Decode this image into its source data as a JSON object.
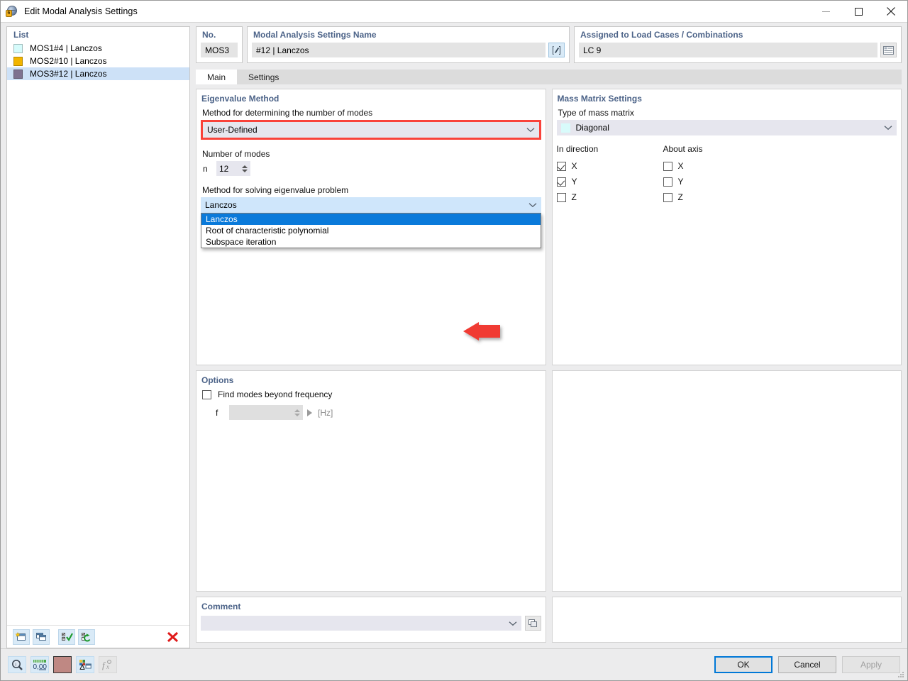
{
  "window": {
    "title": "Edit Modal Analysis Settings",
    "icon": "modal-analysis-icon",
    "minimize": "–",
    "maximize": "□",
    "close": "✕"
  },
  "list_panel": {
    "legend": "List",
    "rows": [
      {
        "color": "#d6fbfb",
        "no": "MOS1",
        "desc": "#4 | Lanczos",
        "selected": false
      },
      {
        "color": "#f2b500",
        "no": "MOS2",
        "desc": "#10 | Lanczos",
        "selected": false
      },
      {
        "color": "#7e7291",
        "no": "MOS3",
        "desc": "#12 | Lanczos",
        "selected": true
      }
    ],
    "toolbar": [
      {
        "name": "new-item-button",
        "icon": "new-window-icon"
      },
      {
        "name": "copy-item-button",
        "icon": "copy-window-icon"
      },
      {
        "name": "select-all-button",
        "icon": "checklist-check-icon"
      },
      {
        "name": "invert-selection-button",
        "icon": "checklist-refresh-icon"
      },
      {
        "name": "delete-item-button",
        "icon": "red-x-icon"
      }
    ]
  },
  "header": {
    "no": {
      "legend": "No.",
      "value": "MOS3"
    },
    "name": {
      "legend": "Modal Analysis Settings Name",
      "value": "#12 | Lanczos",
      "edit_button_icon": "edit-pencil-icon"
    },
    "assigned": {
      "legend": "Assigned to Load Cases / Combinations",
      "value": "LC 9",
      "button_icon": "list-table-icon"
    }
  },
  "tabs": [
    {
      "label": "Main",
      "active": true
    },
    {
      "label": "Settings",
      "active": false
    }
  ],
  "eigenvalue_method": {
    "legend": "Eigenvalue Method",
    "number_of_modes_method": {
      "label": "Method for determining the number of modes",
      "value": "User-Defined",
      "highlighted": true,
      "highlight_color": "#f9423a"
    },
    "number_of_modes": {
      "label": "Number of modes",
      "symbol": "n",
      "value": "12"
    },
    "solving_method": {
      "label": "Method for solving eigenvalue problem",
      "value": "Lanczos",
      "open": true,
      "options": [
        {
          "label": "Lanczos",
          "selected": true
        },
        {
          "label": "Root of characteristic polynomial",
          "selected": false
        },
        {
          "label": "Subspace iteration",
          "selected": false
        }
      ]
    }
  },
  "mass_matrix": {
    "legend": "Mass Matrix Settings",
    "type_label": "Type of mass matrix",
    "type_value": "Diagonal",
    "type_swatch": "#d8fbfb",
    "in_direction_header": "In direction",
    "about_axis_header": "About axis",
    "in_direction": [
      {
        "label": "X",
        "checked": true
      },
      {
        "label": "Y",
        "checked": true
      },
      {
        "label": "Z",
        "checked": false
      }
    ],
    "about_axis": [
      {
        "label": "X",
        "checked": false
      },
      {
        "label": "Y",
        "checked": false
      },
      {
        "label": "Z",
        "checked": false
      }
    ]
  },
  "options": {
    "legend": "Options",
    "find_modes": {
      "label": "Find modes beyond frequency",
      "checked": false
    },
    "frequency": {
      "symbol": "f",
      "value": "",
      "unit": "[Hz]",
      "enabled": false
    }
  },
  "comment": {
    "legend": "Comment",
    "value": "",
    "button_icon": "copy-comment-icon"
  },
  "footer": {
    "tools": [
      {
        "name": "inspect-button",
        "icon": "magnifier-icon"
      },
      {
        "name": "decimal-places-button",
        "icon": "number-format-icon"
      },
      {
        "name": "color-swatch-button",
        "icon": "color-swatch-icon",
        "color": "#bf8883"
      },
      {
        "name": "render-settings-button",
        "icon": "chart-window-icon"
      },
      {
        "name": "formula-button",
        "icon": "function-icon",
        "disabled": true
      }
    ],
    "ok": "OK",
    "cancel": "Cancel",
    "apply": "Apply",
    "apply_disabled": true
  }
}
